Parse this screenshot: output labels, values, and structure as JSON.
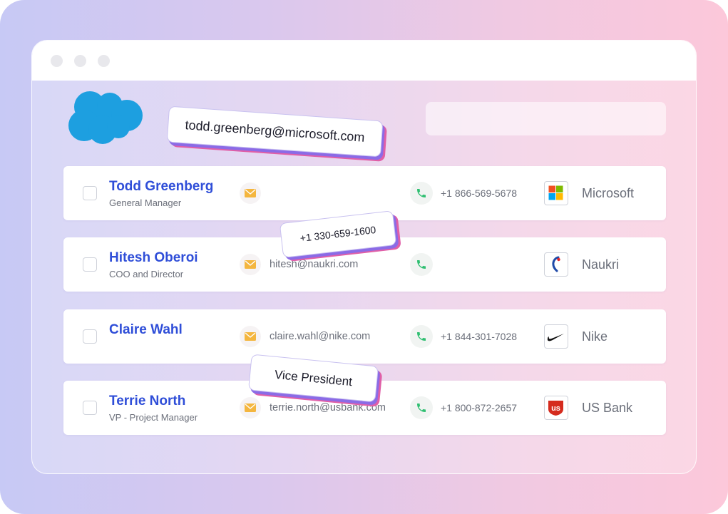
{
  "app": {
    "brand_icon": "salesforce-cloud-icon",
    "brand_color": "#1d9fe0"
  },
  "search": {
    "placeholder": ""
  },
  "contacts": [
    {
      "name": "Todd Greenberg",
      "title": "General Manager",
      "email": "",
      "phone": "+1 866-569-5678",
      "company": "Microsoft",
      "logo": "microsoft-logo"
    },
    {
      "name": "Hitesh Oberoi",
      "title": "COO and Director",
      "email": "hitesh@naukri.com",
      "phone": "",
      "company": "Naukri",
      "logo": "naukri-logo"
    },
    {
      "name": "Claire Wahl",
      "title": "",
      "email": "claire.wahl@nike.com",
      "phone": "+1 844-301-7028",
      "company": "Nike",
      "logo": "nike-logo"
    },
    {
      "name": "Terrie North",
      "title": "VP - Project Manager",
      "email": "terrie.north@usbank.com",
      "phone": "+1 800-872-2657",
      "company": "US Bank",
      "logo": "us-bank-logo"
    }
  ],
  "floating_tags": {
    "email": "todd.greenberg@microsoft.com",
    "phone": "+1 330-659-1600",
    "title": "Vice President"
  },
  "colors": {
    "name": "#2f4ed8",
    "mail_icon": "#f4b63f",
    "phone_icon": "#2fbf71",
    "tag_shadow_purple": "#8b6be6",
    "tag_shadow_pink": "#e05fa7"
  }
}
